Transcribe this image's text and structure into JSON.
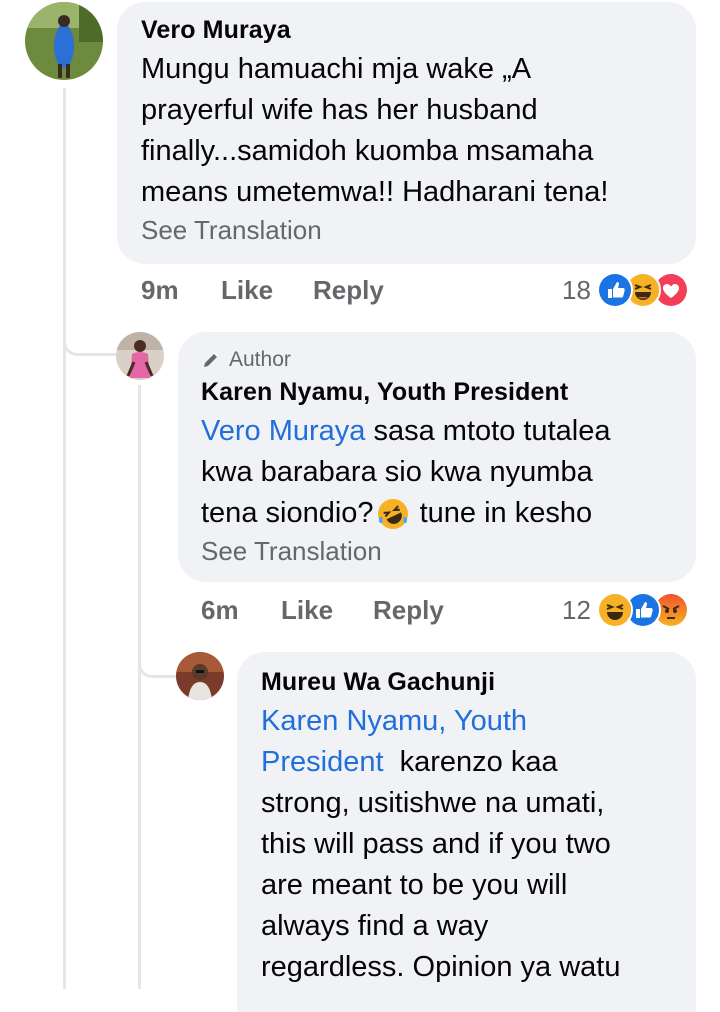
{
  "comments": [
    {
      "author": "Vero Muraya",
      "text_lines": [
        "Mungu hamuachi mja wake „A",
        "prayerful wife has her husband",
        "finally...samidoh kuomba msamaha",
        "means umetemwa!!  Hadharani tena!"
      ],
      "see_translation": "See Translation",
      "time": "9m",
      "like_label": "Like",
      "reply_label": "Reply",
      "reaction_count": "18",
      "reactions": [
        "like-icon",
        "haha-icon",
        "love-icon"
      ]
    },
    {
      "author_badge": "Author",
      "author": "Karen Nyamu, Youth President",
      "mention": "Vero Muraya",
      "line1_rest": " sasa mtoto tutalea",
      "line2": "kwa barabara sio kwa nyumba",
      "line3_before": "tena siondio?",
      "line3_after": " tune in kesho",
      "see_translation": "See Translation",
      "time": "6m",
      "like_label": "Like",
      "reply_label": "Reply",
      "reaction_count": "12",
      "reactions": [
        "haha-icon",
        "like-icon",
        "angry-icon"
      ]
    },
    {
      "author": "Mureu Wa Gachunji",
      "mention_line1": "Karen Nyamu, Youth",
      "mention_line2": "President",
      "line2_rest": "  karenzo kaa",
      "lines": [
        "strong, usitishwe na umati,",
        "this will pass and if you two",
        "are meant to be you will",
        "always find a way",
        "regardless. Opinion ya watu"
      ]
    }
  ],
  "colors": {
    "bubble": "#f0f2f5",
    "mention": "#216fdb",
    "meta": "#65676b",
    "like_blue": "#1b74e4",
    "love_red": "#f33e58",
    "haha_yellow": "#f7b125",
    "angry_orange": "#e9710f"
  }
}
